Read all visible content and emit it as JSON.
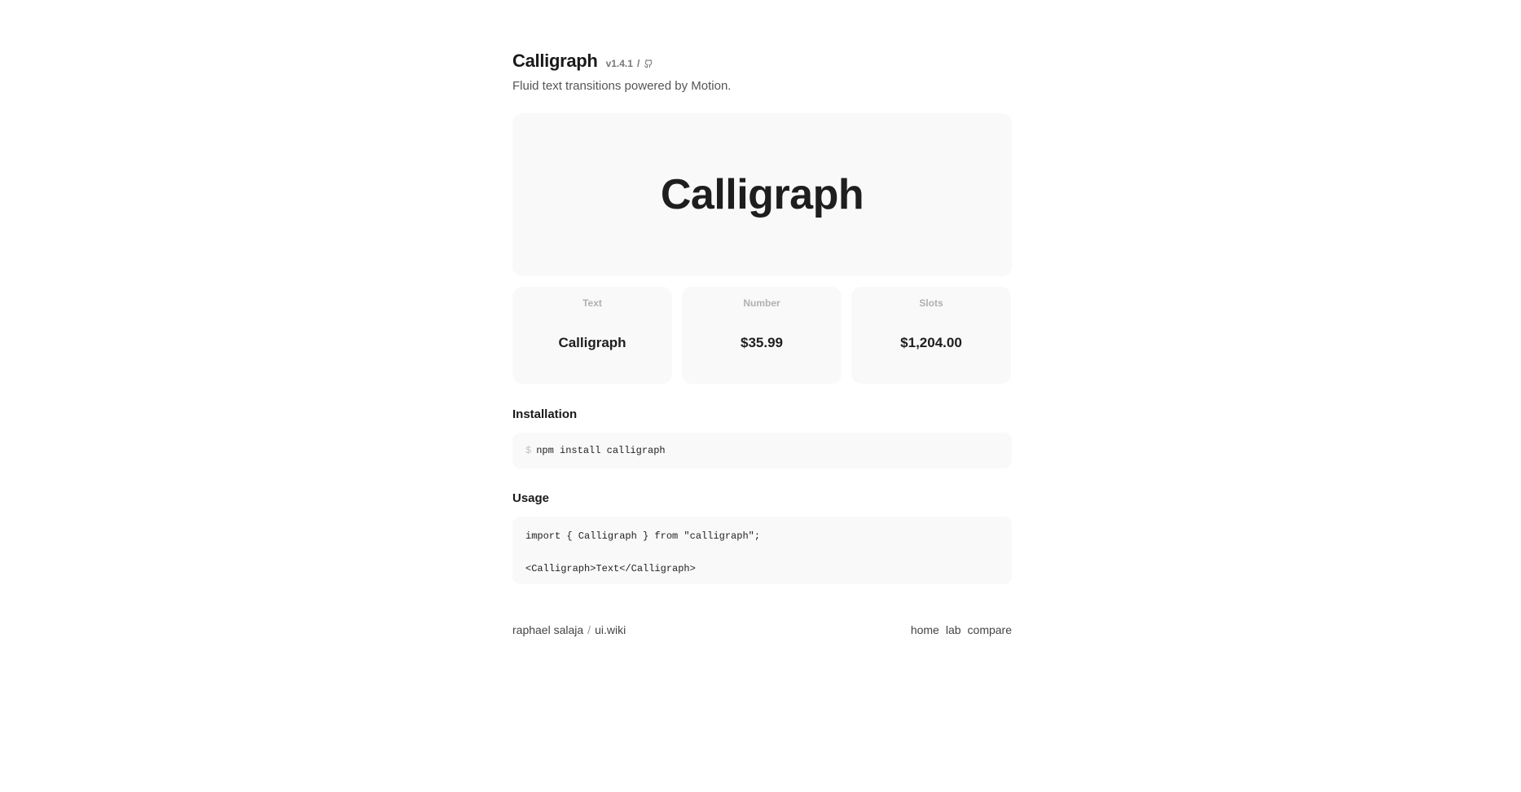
{
  "header": {
    "title": "Calligraph",
    "version": "v1.4.1",
    "separator": "/",
    "github_icon": "github-icon",
    "subtitle": "Fluid text transitions powered by Motion."
  },
  "hero": {
    "text": "Calligraph"
  },
  "cards": [
    {
      "label": "Text",
      "value": "Calligraph"
    },
    {
      "label": "Number",
      "value": "$35.99"
    },
    {
      "label": "Slots",
      "value": "$1,204.00"
    }
  ],
  "installation": {
    "title": "Installation",
    "prompt": "$",
    "command": "npm install calligraph"
  },
  "usage": {
    "title": "Usage",
    "lines": [
      "import { Calligraph } from \"calligraph\";",
      "<Calligraph>Text</Calligraph>"
    ]
  },
  "footer": {
    "author": "raphael salaja",
    "separator": "/",
    "site": "ui.wiki",
    "links": [
      "home",
      "lab",
      "compare"
    ]
  }
}
